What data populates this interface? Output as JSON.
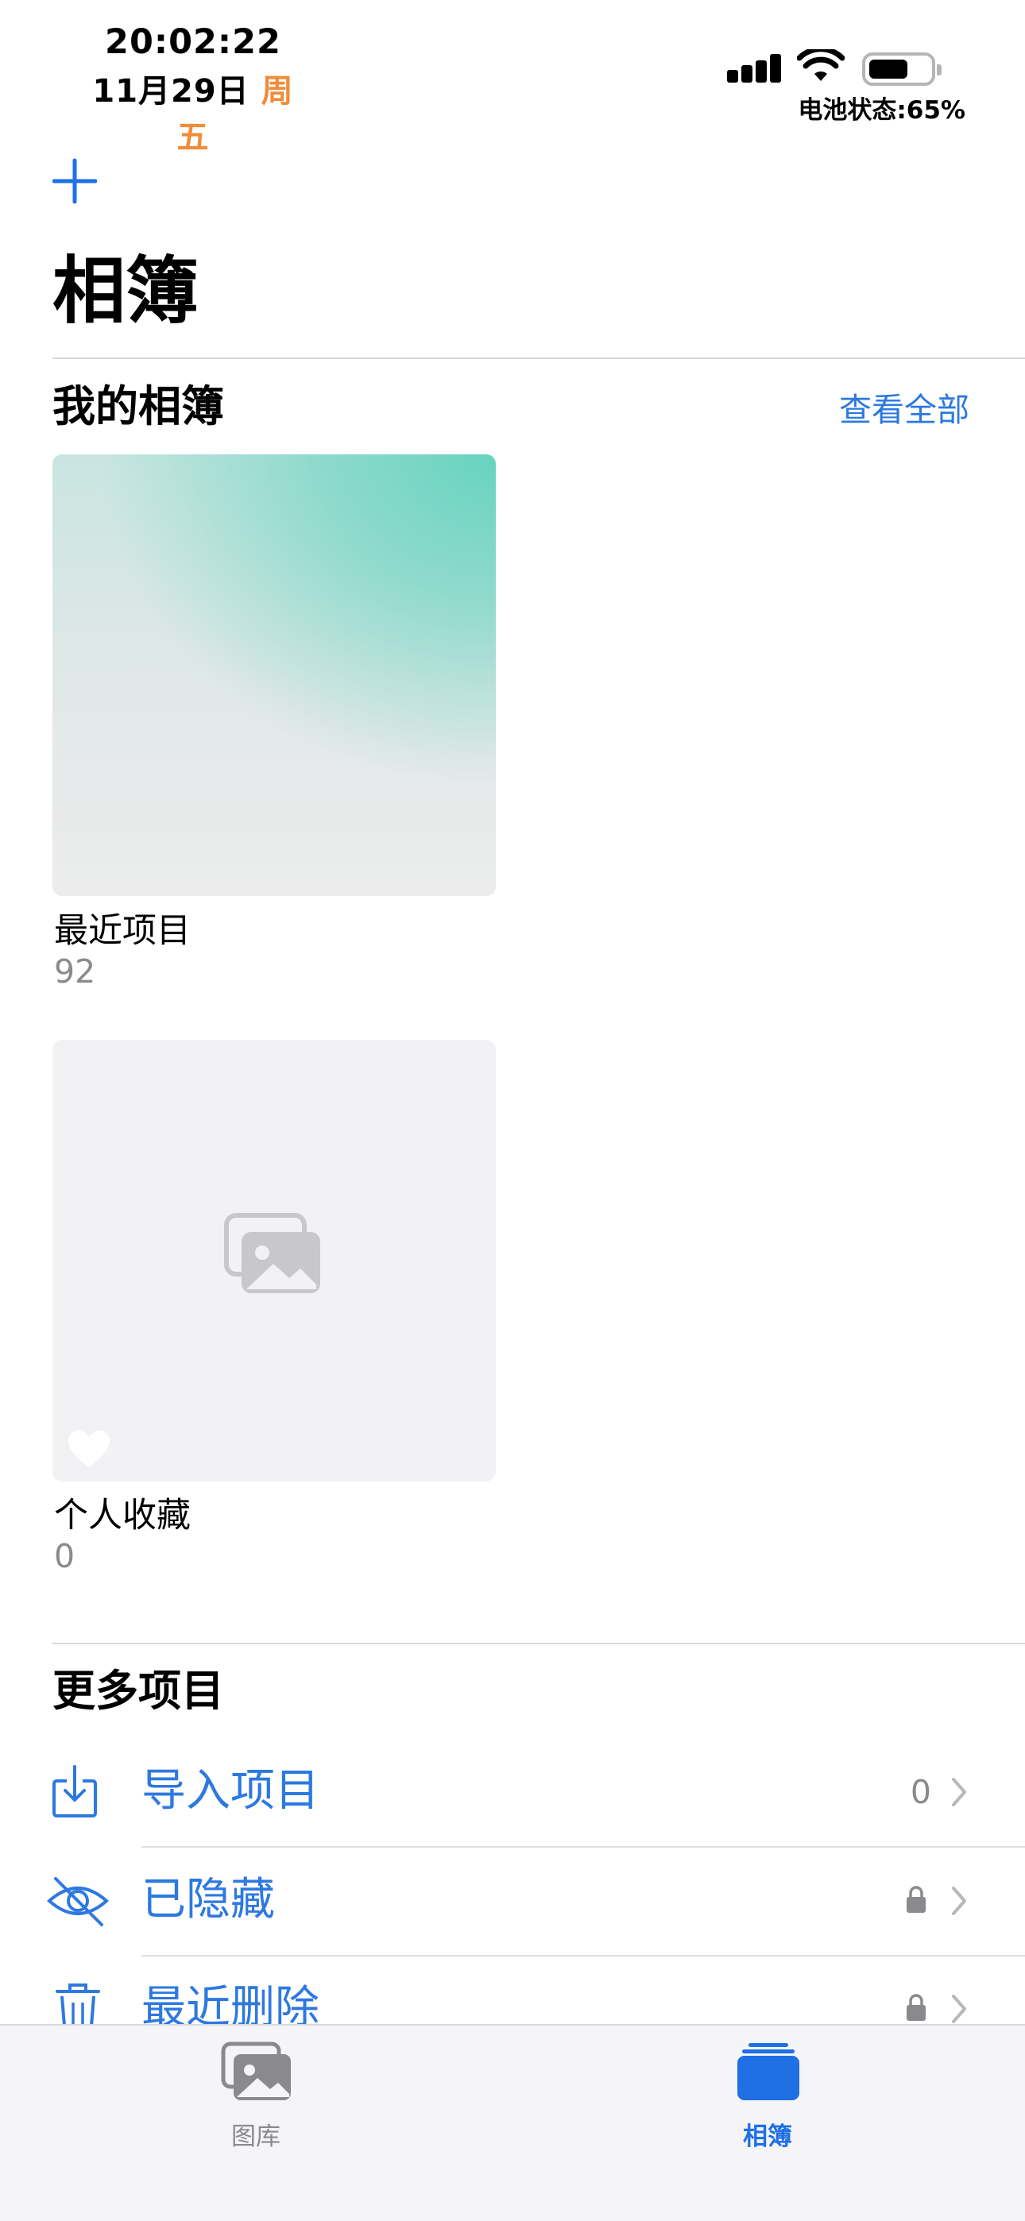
{
  "status_bar": {
    "time": "20:02:22",
    "date": "11月29日",
    "weekday": "周五",
    "battery_text": "电池状态:65%",
    "battery_level": 0.65
  },
  "header": {
    "title": "相簿",
    "add_icon": "plus-icon"
  },
  "my_albums": {
    "title": "我的相簿",
    "see_all": "查看全部",
    "albums": [
      {
        "name": "最近项目",
        "count": "92"
      },
      {
        "name": "个人收藏",
        "count": "0"
      }
    ]
  },
  "more_items": {
    "title": "更多项目",
    "items": [
      {
        "label": "导入项目",
        "icon": "import-icon",
        "count": "0",
        "locked": false
      },
      {
        "label": "已隐藏",
        "icon": "hidden-eye-icon",
        "count": "",
        "locked": true
      },
      {
        "label": "最近删除",
        "icon": "trash-icon",
        "count": "",
        "locked": true
      }
    ]
  },
  "tab_bar": {
    "tabs": [
      {
        "label": "图库",
        "icon": "photo-library-icon",
        "active": false
      },
      {
        "label": "相簿",
        "icon": "albums-stack-icon",
        "active": true
      }
    ]
  },
  "colors": {
    "accent": "#1f6fe5",
    "weekday": "#f08c3a",
    "secondary_text": "#8a8a8e"
  }
}
